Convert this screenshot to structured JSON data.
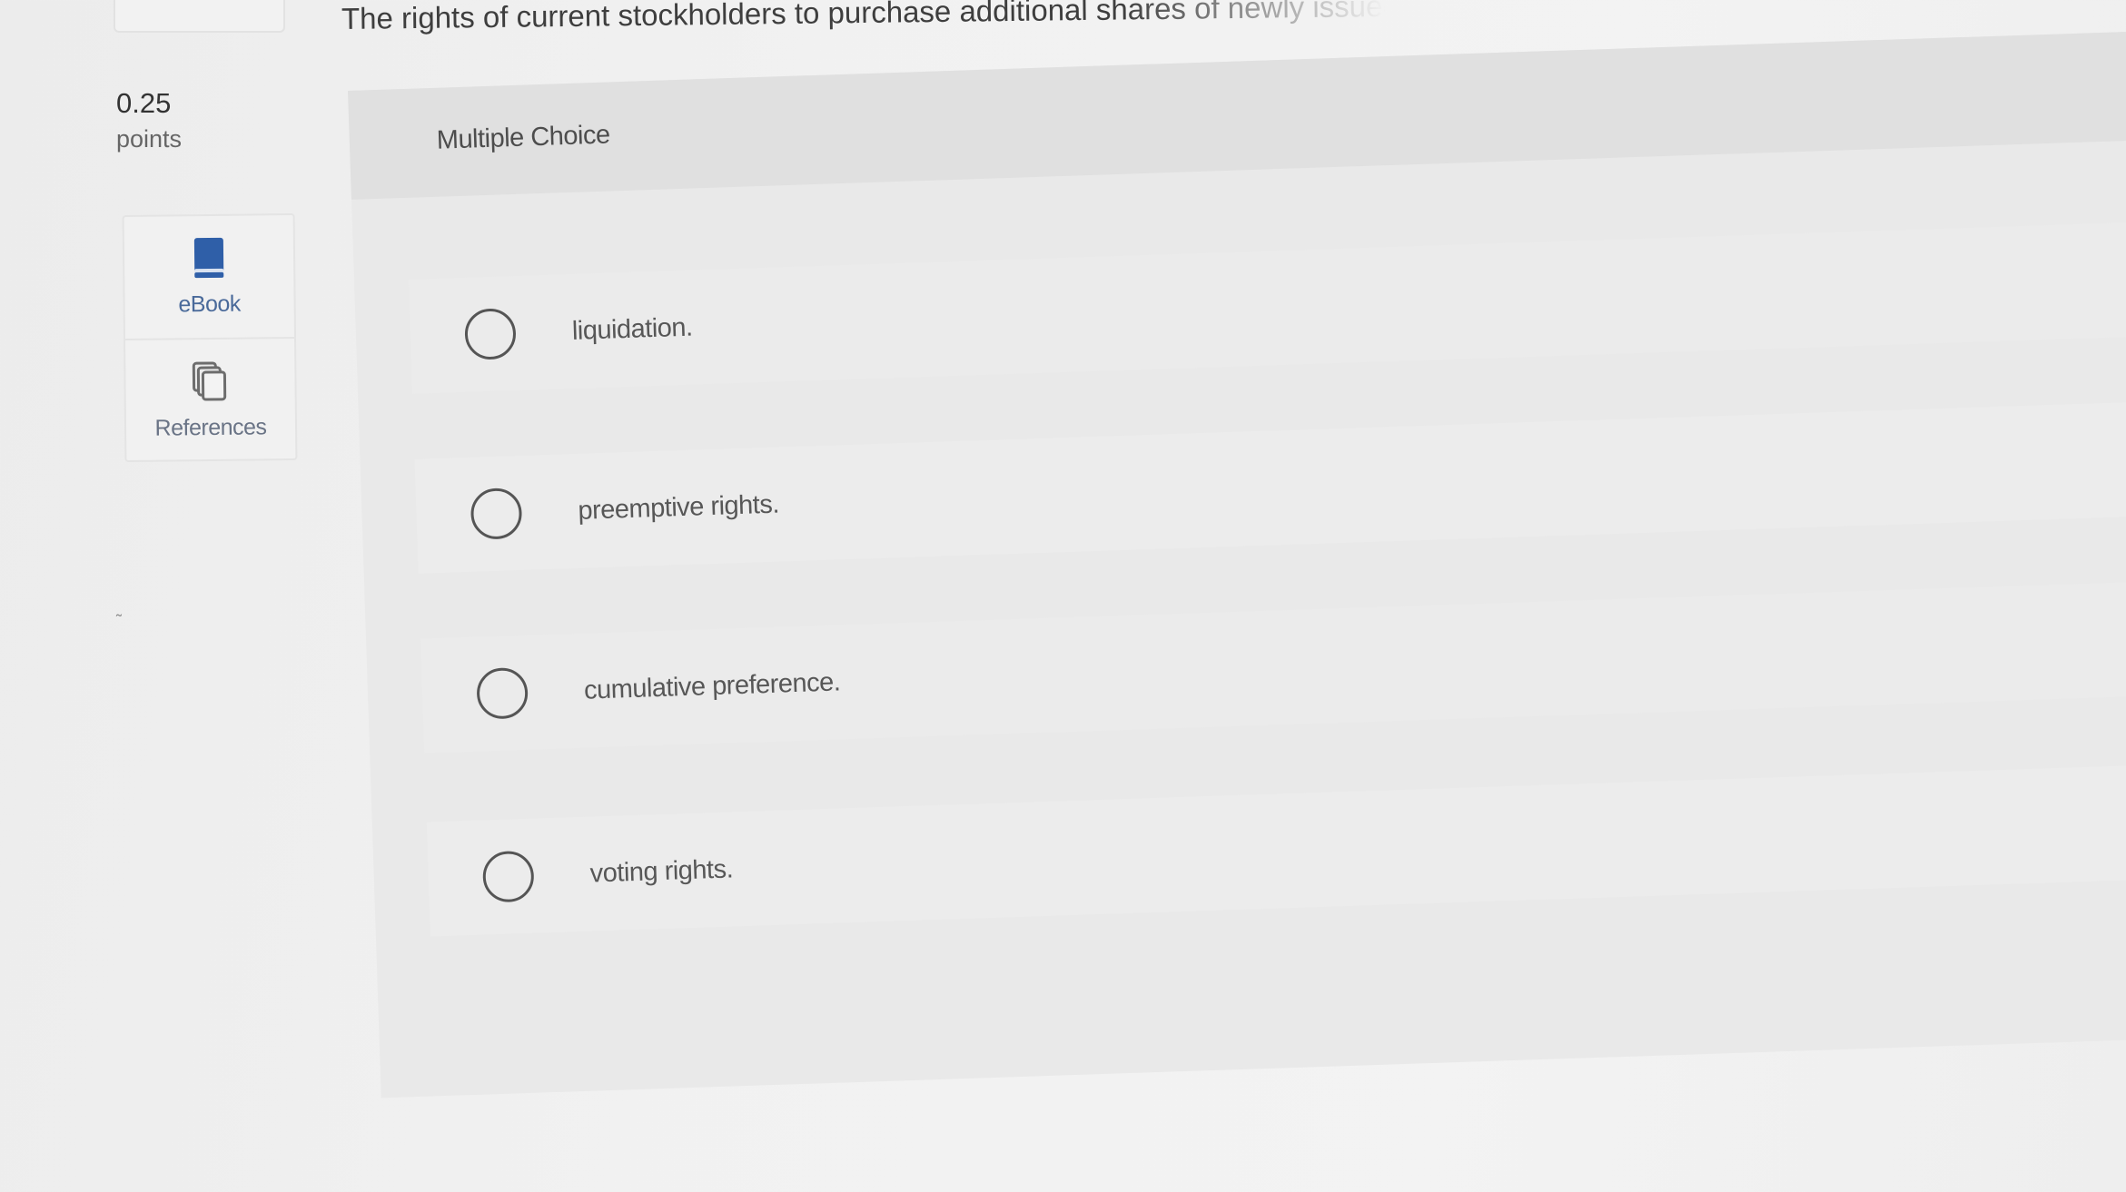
{
  "question": {
    "text": "The rights of current stockholders to purchase additional shares of newly issued stock"
  },
  "points": {
    "value": "0.25",
    "label": "points"
  },
  "tools": {
    "ebook": {
      "label": "eBook",
      "icon": "book-icon"
    },
    "references": {
      "label": "References",
      "icon": "stacked-pages-icon"
    }
  },
  "question_type": "Multiple Choice",
  "options": [
    {
      "label": "liquidation."
    },
    {
      "label": "preemptive rights."
    },
    {
      "label": "cumulative preference."
    },
    {
      "label": "voting rights."
    }
  ],
  "colors": {
    "book_icon": "#2f5fa8",
    "radio_border": "#555555",
    "panel_bg": "#e9e9e9"
  }
}
